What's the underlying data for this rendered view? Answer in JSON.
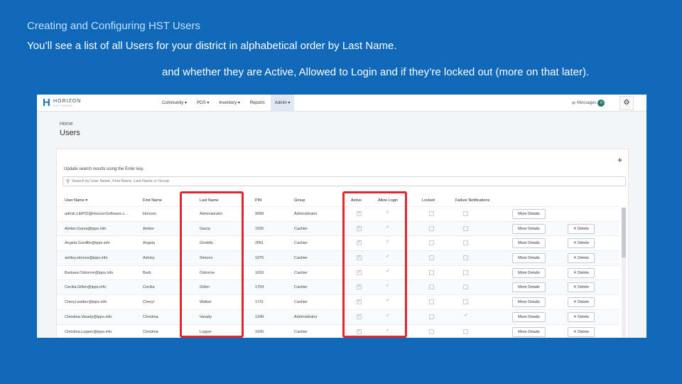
{
  "slide": {
    "title": "Creating and Configuring HST Users",
    "line1": "You’ll see a list of all Users for your district in alphabetical order by Last Name.",
    "line2": "and whether they are Active, Allowed to Login and if they’re locked out (more on that later)."
  },
  "app": {
    "logo_text": "HORIZON",
    "logo_sub": "SOFTWARE",
    "nav": [
      "Community ▾",
      "POS ▾",
      "Inventory ▾",
      "Reports",
      "Admin ▾"
    ],
    "active_nav": "Admin ▾",
    "messages_label": "Messages",
    "messages_count": "0",
    "gear_icon": "gear-icon",
    "breadcrumb": "Home",
    "page_title": "Users",
    "add_icon": "+",
    "hint": "Update search results using the Enter key.",
    "search_placeholder": "Search by User Name, First Name, Last Name or Group",
    "columns": {
      "user_name": "User Name ▾",
      "first_name": "First Name",
      "last_name": "Last Name",
      "pin": "PIN",
      "group": "Group",
      "active": "Active",
      "allow_login": "Allow Login",
      "locked": "Locked",
      "failure": "Failure Notifications"
    },
    "more_details_label": "More Details",
    "delete_label": "✕ Delete",
    "rows": [
      {
        "user": "admin.LibP02@HorizonSoftware.c...",
        "first": "Horizon",
        "last": "Administrator",
        "pin": "9999",
        "group": "Administrator",
        "active": "✓",
        "allow": "✓",
        "locked": "",
        "failure": "",
        "del": ""
      },
      {
        "user": "Amber.Garza@ipps.info",
        "first": "Amber",
        "last": "Garza",
        "pin": "1926",
        "group": "Cashier",
        "active": "✓",
        "allow": "✓",
        "locked": "",
        "failure": "",
        "del": "✕ Delete"
      },
      {
        "user": "Angela.Gordillo@ipps.info",
        "first": "Angela",
        "last": "Gordillo",
        "pin": "2061",
        "group": "Cashier",
        "active": "✓",
        "allow": "✓",
        "locked": "",
        "failure": "",
        "del": "✕ Delete"
      },
      {
        "user": "ashley.simons@ipps.info",
        "first": "Ashley",
        "last": "Simons",
        "pin": "1975",
        "group": "Cashier",
        "active": "✓",
        "allow": "✓",
        "locked": "",
        "failure": "",
        "del": "✕ Delete"
      },
      {
        "user": "Barbara.Osborne@ipps.info",
        "first": "Barb",
        "last": "Osborne",
        "pin": "1093",
        "group": "Cashier",
        "active": "✓",
        "allow": "✓",
        "locked": "",
        "failure": "",
        "del": "✕ Delete"
      },
      {
        "user": "Cecilia.Gillen@ipps.info",
        "first": "Cecilia",
        "last": "Gillen",
        "pin": "1754",
        "group": "Cashier",
        "active": "✓",
        "allow": "✓",
        "locked": "",
        "failure": "",
        "del": "✕ Delete"
      },
      {
        "user": "Cheryl.walker@ipps.info",
        "first": "Cheryl",
        "last": "Walker",
        "pin": "1731",
        "group": "Cashier",
        "active": "✓",
        "allow": "✓",
        "locked": "",
        "failure": "",
        "del": "✕ Delete"
      },
      {
        "user": "Christina.Varady@ipps.info",
        "first": "Christina",
        "last": "Varady",
        "pin": "1349",
        "group": "Administrator",
        "active": "✓",
        "allow": "✓",
        "locked": "",
        "failure": "✓",
        "del": "✕ Delete"
      },
      {
        "user": "Christina.Lopper@ipps.info",
        "first": "Christina",
        "last": "Lopper",
        "pin": "1930",
        "group": "Cashier",
        "active": "✓",
        "allow": "✓",
        "locked": "",
        "failure": "",
        "del": "✕ Delete"
      }
    ]
  },
  "highlight_color": "#e3262b"
}
